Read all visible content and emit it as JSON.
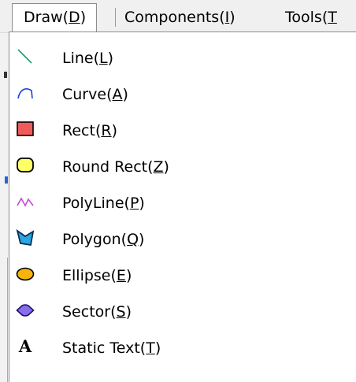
{
  "menubar": {
    "items": [
      {
        "label": "Draw",
        "mnemonic": "D"
      },
      {
        "label": "Components",
        "mnemonic": "I"
      },
      {
        "label": "Tools",
        "mnemonic": "T"
      }
    ]
  },
  "dropdown": {
    "items": [
      {
        "label": "Line",
        "mnemonic": "L",
        "icon": "line-icon",
        "color": "#1a9f6a"
      },
      {
        "label": "Curve",
        "mnemonic": "A",
        "icon": "curve-icon",
        "color": "#1f3fe0"
      },
      {
        "label": "Rect",
        "mnemonic": "R",
        "icon": "rect-icon",
        "color": "#f05a5a"
      },
      {
        "label": "Round Rect",
        "mnemonic": "Z",
        "icon": "round-rect-icon",
        "color": "#ffff66"
      },
      {
        "label": "PolyLine",
        "mnemonic": "P",
        "icon": "polyline-icon",
        "color": "#c64bd8"
      },
      {
        "label": "Polygon",
        "mnemonic": "Q",
        "icon": "polygon-icon",
        "color": "#2aa7de"
      },
      {
        "label": "Ellipse",
        "mnemonic": "E",
        "icon": "ellipse-icon",
        "color": "#f6b40d"
      },
      {
        "label": "Sector",
        "mnemonic": "S",
        "icon": "sector-icon",
        "color": "#8a6ee8"
      },
      {
        "label": "Static Text",
        "mnemonic": "T",
        "icon": "static-text-icon",
        "color": "#000000"
      }
    ]
  }
}
